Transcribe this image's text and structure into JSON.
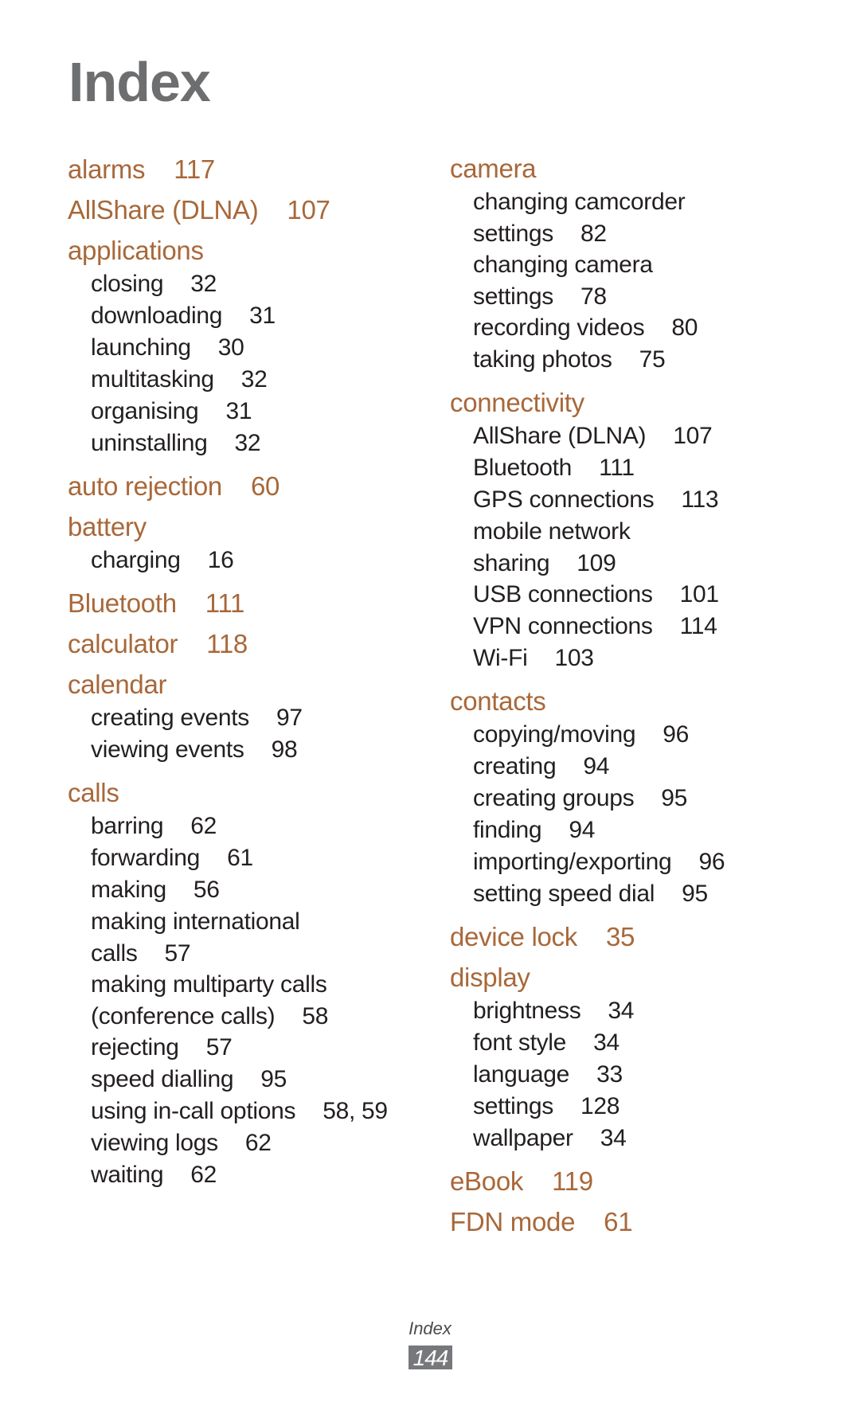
{
  "page": {
    "title": "Index",
    "footer": {
      "section_label": "Index",
      "page_number": "144"
    },
    "colors": {
      "heading": "#a8683a",
      "subentry": "#231f20",
      "title": "#6d6e70",
      "page_badge": "#77787b"
    }
  },
  "columns": [
    {
      "entries": [
        {
          "term": "alarms",
          "page": "117"
        },
        {
          "term": "AllShare (DLNA)",
          "page": "107"
        },
        {
          "term": "applications",
          "subentries": [
            {
              "lines": [
                "closing"
              ],
              "page": "32"
            },
            {
              "lines": [
                "downloading"
              ],
              "page": "31"
            },
            {
              "lines": [
                "launching"
              ],
              "page": "30"
            },
            {
              "lines": [
                "multitasking"
              ],
              "page": "32"
            },
            {
              "lines": [
                "organising"
              ],
              "page": "31"
            },
            {
              "lines": [
                "uninstalling"
              ],
              "page": "32"
            }
          ]
        },
        {
          "term": "auto rejection",
          "page": "60"
        },
        {
          "term": "battery",
          "subentries": [
            {
              "lines": [
                "charging"
              ],
              "page": "16"
            }
          ]
        },
        {
          "term": "Bluetooth",
          "page": "111"
        },
        {
          "term": "calculator",
          "page": "118"
        },
        {
          "term": "calendar",
          "subentries": [
            {
              "lines": [
                "creating events"
              ],
              "page": "97"
            },
            {
              "lines": [
                "viewing events"
              ],
              "page": "98"
            }
          ]
        },
        {
          "term": "calls",
          "subentries": [
            {
              "lines": [
                "barring"
              ],
              "page": "62"
            },
            {
              "lines": [
                "forwarding"
              ],
              "page": "61"
            },
            {
              "lines": [
                "making"
              ],
              "page": "56"
            },
            {
              "lines": [
                "making international",
                "calls"
              ],
              "page": "57"
            },
            {
              "lines": [
                "making multiparty calls",
                "(conference calls)"
              ],
              "page": "58"
            },
            {
              "lines": [
                "rejecting"
              ],
              "page": "57"
            },
            {
              "lines": [
                "speed dialling"
              ],
              "page": "95"
            },
            {
              "lines": [
                "using in-call options"
              ],
              "page": "58, 59"
            },
            {
              "lines": [
                "viewing logs"
              ],
              "page": "62"
            },
            {
              "lines": [
                "waiting"
              ],
              "page": "62"
            }
          ]
        }
      ]
    },
    {
      "entries": [
        {
          "term": "camera",
          "subentries": [
            {
              "lines": [
                "changing camcorder",
                "settings"
              ],
              "page": "82"
            },
            {
              "lines": [
                "changing camera",
                "settings"
              ],
              "page": "78"
            },
            {
              "lines": [
                "recording videos"
              ],
              "page": "80"
            },
            {
              "lines": [
                "taking photos"
              ],
              "page": "75"
            }
          ]
        },
        {
          "term": "connectivity",
          "subentries": [
            {
              "lines": [
                "AllShare (DLNA)"
              ],
              "page": "107"
            },
            {
              "lines": [
                "Bluetooth"
              ],
              "page": "111"
            },
            {
              "lines": [
                "GPS connections"
              ],
              "page": "113"
            },
            {
              "lines": [
                "mobile network",
                "sharing"
              ],
              "page": "109"
            },
            {
              "lines": [
                "USB connections"
              ],
              "page": "101"
            },
            {
              "lines": [
                "VPN connections"
              ],
              "page": "114"
            },
            {
              "lines": [
                "Wi-Fi"
              ],
              "page": "103"
            }
          ]
        },
        {
          "term": "contacts",
          "subentries": [
            {
              "lines": [
                "copying/moving"
              ],
              "page": "96"
            },
            {
              "lines": [
                "creating"
              ],
              "page": "94"
            },
            {
              "lines": [
                "creating groups"
              ],
              "page": "95"
            },
            {
              "lines": [
                "finding"
              ],
              "page": "94"
            },
            {
              "lines": [
                "importing/exporting"
              ],
              "page": "96"
            },
            {
              "lines": [
                "setting speed dial"
              ],
              "page": "95"
            }
          ]
        },
        {
          "term": "device lock",
          "page": "35"
        },
        {
          "term": "display",
          "subentries": [
            {
              "lines": [
                "brightness"
              ],
              "page": "34"
            },
            {
              "lines": [
                "font style"
              ],
              "page": "34"
            },
            {
              "lines": [
                "language"
              ],
              "page": "33"
            },
            {
              "lines": [
                "settings"
              ],
              "page": "128"
            },
            {
              "lines": [
                "wallpaper"
              ],
              "page": "34"
            }
          ]
        },
        {
          "term": "eBook",
          "page": "119"
        },
        {
          "term": "FDN mode",
          "page": "61"
        }
      ]
    }
  ]
}
